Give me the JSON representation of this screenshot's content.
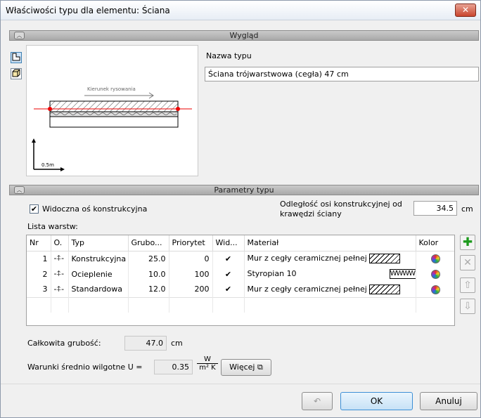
{
  "window": {
    "title": "Właściwości typu dla elementu: Ściana",
    "close_glyph": "✕"
  },
  "appearance": {
    "section_title": "Wygląd",
    "type_name_label": "Nazwa typu",
    "type_name_value": "Ściana trójwarstwowa (cegła) 47 cm",
    "preview_direction_label": "Kierunek rysowania",
    "preview_scale_label": "0.5m"
  },
  "parameters": {
    "section_title": "Parametry typu",
    "visible_axis_label": "Widoczna oś konstrukcyjna",
    "visible_axis_checked": true,
    "axis_offset_label_line1": "Odległość osi konstrukcyjnej od",
    "axis_offset_label_line2": "krawędzi ściany",
    "axis_offset_value": "34.5",
    "axis_offset_unit": "cm",
    "layers_label": "Lista warstw:",
    "columns": {
      "nr": "Nr",
      "o": "O.",
      "type": "Typ",
      "thickness": "Grubo...",
      "priority": "Priorytet",
      "visible": "Wid...",
      "material": "Materiał",
      "color": "Kolor"
    },
    "rows": [
      {
        "nr": "1",
        "type": "Konstrukcyjna",
        "thickness": "25.0",
        "priority": "0",
        "visible": "✔",
        "material": "Mur z cegły ceramicznej pełnej",
        "pattern": "hatch"
      },
      {
        "nr": "2",
        "type": "Ocieplenie",
        "thickness": "10.0",
        "priority": "100",
        "visible": "✔",
        "material": "Styropian 10",
        "pattern": "wave"
      },
      {
        "nr": "3",
        "type": "Standardowa",
        "thickness": "12.0",
        "priority": "200",
        "visible": "✔",
        "material": "Mur z cegły ceramicznej pełnej",
        "pattern": "hatch"
      }
    ],
    "total_label": "Całkowita grubość:",
    "total_value": "47.0",
    "total_unit": "cm",
    "humidity_label": "Warunki średnio wilgotne U =",
    "u_value": "0.35",
    "u_unit_num": "W",
    "u_unit_den": "m² K",
    "more_button": "Więcej"
  },
  "footer": {
    "ok": "OK",
    "cancel": "Anuluj"
  }
}
